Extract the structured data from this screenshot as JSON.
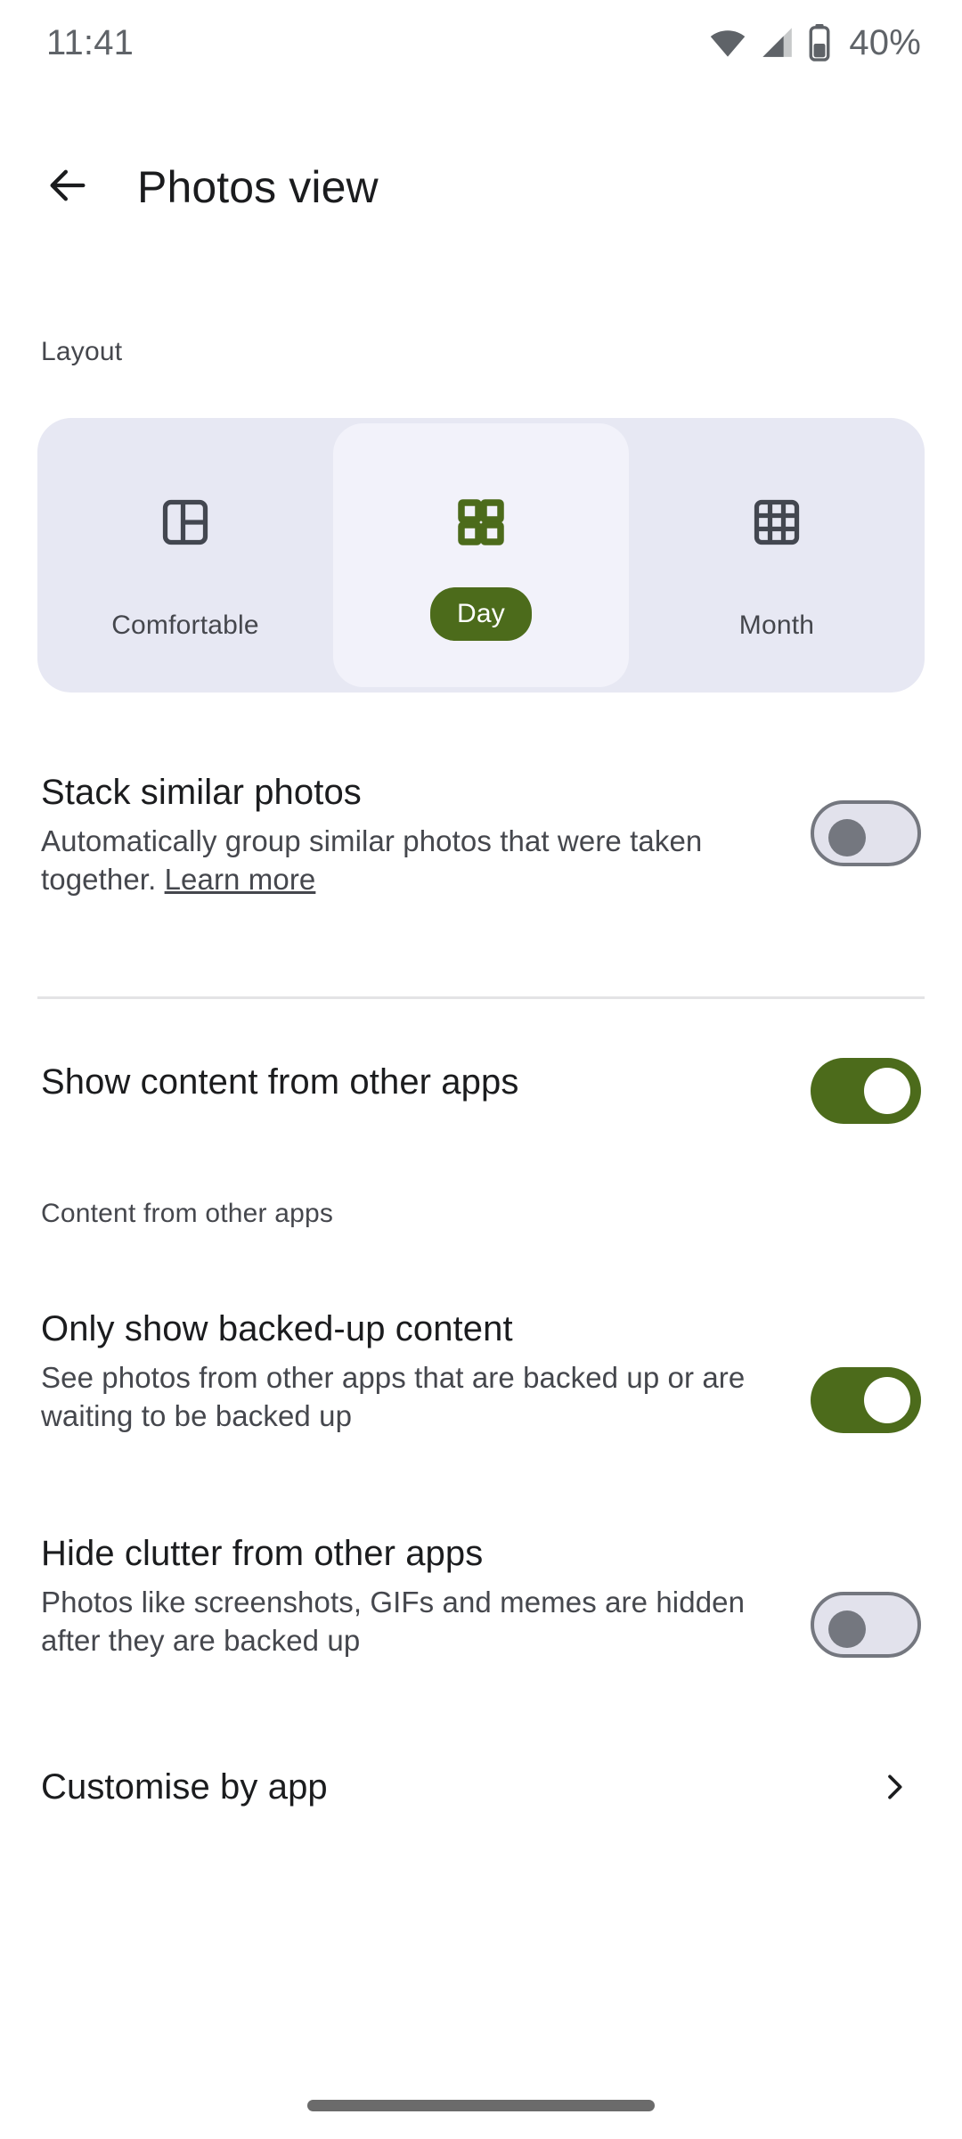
{
  "status_bar": {
    "time": "11:41",
    "battery_percent": "40%",
    "wifi_icon": "wifi-icon",
    "signal_icon": "cellular-signal-icon",
    "battery_icon": "battery-icon"
  },
  "app_bar": {
    "back_icon": "back-arrow-icon",
    "title": "Photos view"
  },
  "layout_section": {
    "label": "Layout",
    "selected": "Day",
    "options": [
      {
        "label": "Comfortable",
        "icon": "comfortable-layout-icon",
        "selected": false
      },
      {
        "label": "Day",
        "icon": "day-grid-icon",
        "selected": true
      },
      {
        "label": "Month",
        "icon": "month-grid-icon",
        "selected": false
      }
    ]
  },
  "settings": [
    {
      "title": "Stack similar photos",
      "desc_before_link": "Automatically group similar photos that were taken together. ",
      "link": "Learn more",
      "toggle_state": "off"
    },
    {
      "title": "Show content from other apps",
      "toggle_state": "on"
    },
    {
      "title": "Only show backed-up content",
      "desc": "See photos from other apps that are backed up or are waiting to be backed up",
      "toggle_state": "on"
    },
    {
      "title": "Hide clutter from other apps",
      "desc": "Photos like screenshots, GIFs and memes are hidden after they are backed up",
      "toggle_state": "off"
    }
  ],
  "subsection_label": "Content from other apps",
  "customise_row": {
    "title": "Customise by app",
    "chevron_icon": "chevron-right-icon"
  },
  "colors": {
    "accent_green": "#4c6b1b",
    "segmented_track": "#e7e8f3",
    "selected_segment": "#f2f2fa",
    "toggle_off_track": "#e2e2ec",
    "toggle_off_outline": "#74777f",
    "text_primary": "#1b1c1e",
    "text_secondary": "#45474d"
  }
}
